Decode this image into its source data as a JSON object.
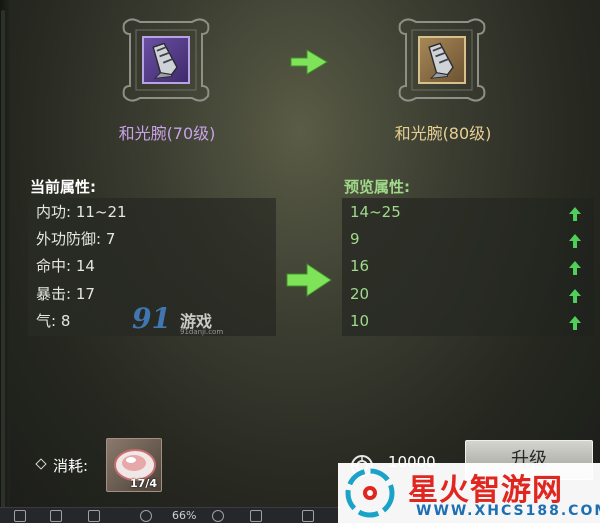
{
  "current_item": {
    "name": "和光腕(70级)",
    "icon": "gauntlet-icon",
    "rarity_color": "#c7a2e6"
  },
  "target_item": {
    "name": "和光腕(80级)",
    "icon": "gauntlet-icon",
    "rarity_color": "#e7cf92"
  },
  "current_stats": {
    "title": "当前属性:",
    "rows": [
      {
        "text": "内功: 11~21"
      },
      {
        "text": "外功防御: 7"
      },
      {
        "text": "命中: 14"
      },
      {
        "text": "暴击: 17"
      },
      {
        "text": "气: 8"
      }
    ]
  },
  "preview_stats": {
    "title": "预览属性:",
    "rows": [
      {
        "text": "14~25",
        "trend": "up-arrow-icon"
      },
      {
        "text": "9",
        "trend": "up-arrow-icon"
      },
      {
        "text": "16",
        "trend": "up-arrow-icon"
      },
      {
        "text": "20",
        "trend": "up-arrow-icon"
      },
      {
        "text": "10",
        "trend": "up-arrow-icon"
      }
    ],
    "accent_color": "#9fd98a"
  },
  "cost": {
    "label": "消耗:",
    "material_icon": "crystal-icon",
    "material_count": "17/4",
    "currency_icon": "coin-icon",
    "currency_amount": "10000"
  },
  "upgrade_button": {
    "label": "升级"
  },
  "toolbar": {
    "zoom": "66%"
  },
  "watermarks": {
    "site_91": {
      "number": "91",
      "text": "游戏",
      "url": "91danji.com"
    },
    "brand": {
      "title": "星火智游网",
      "url": "WWW.XHCS188.COM"
    }
  }
}
